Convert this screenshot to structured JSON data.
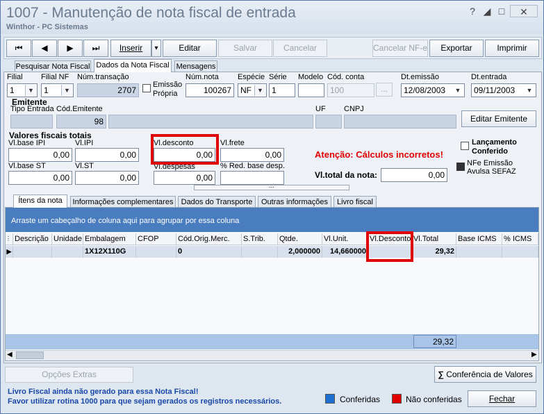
{
  "window": {
    "title": "1007 - Manutenção de nota fiscal de entrada",
    "subtitle": "Winthor - PC Sistemas",
    "help": "?",
    "minimize": "◢",
    "maximize": "□",
    "close": "✕"
  },
  "toolbar": {
    "first": "⏮",
    "prev": "◀",
    "next": "▶",
    "last": "⏭",
    "inserir": "Inserir",
    "inserir_dd": "▾",
    "editar": "Editar",
    "salvar": "Salvar",
    "cancelar": "Cancelar",
    "cancelar_nfe": "Cancelar NF-e",
    "exportar": "Exportar",
    "imprimir": "Imprimir"
  },
  "tabs": [
    "Pesquisar Nota Fiscal",
    "Dados da Nota Fiscal",
    "Mensagens"
  ],
  "header_fields": {
    "filial_label": "Filial",
    "filial_value": "1",
    "filial_nf_label": "Filial NF",
    "filial_nf_value": "1",
    "num_transacao_label": "Núm.transação",
    "num_transacao_value": "2707",
    "emissao_propria_line1": "Emissão",
    "emissao_propria_line2": "Própria",
    "num_nota_label": "Núm.nota",
    "num_nota_value": "100267",
    "especie_label": "Espécie",
    "especie_value": "NF",
    "serie_label": "Série",
    "serie_value": "1",
    "modelo_label": "Modelo",
    "modelo_value": "",
    "cod_conta_label": "Cód. conta",
    "cod_conta_value": "100",
    "cod_conta_btn": "...",
    "dt_emissao_label": "Dt.emissão",
    "dt_emissao_value": "12/08/2003",
    "dt_entrada_label": "Dt.entrada",
    "dt_entrada_value": "09/11/2003"
  },
  "emitente": {
    "section": "Emitente",
    "tipo_entrada_label": "Tipo Entrada",
    "cod_emitente_label": "Cód.Emitente",
    "cod_emitente_value": "98",
    "uf_label": "UF",
    "cnpj_label": "CNPJ",
    "editar_btn": "Editar Emitente"
  },
  "valores": {
    "section": "Valores fiscais totais",
    "base_ipi_label": "Vl.base IPI",
    "base_ipi_value": "0,00",
    "ipi_label": "Vl.IPI",
    "ipi_value": "0,00",
    "desconto_label": "Vl.desconto",
    "desconto_value": "0,00",
    "frete_label": "Vl.frete",
    "frete_value": "0,00",
    "base_st_label": "Vl.base ST",
    "base_st_value": "0,00",
    "st_label": "Vl.ST",
    "st_value": "0,00",
    "despesas_label": "Vl.despesas",
    "despesas_value": "0,00",
    "red_base_label": "% Red. base desp.",
    "red_base_value": "",
    "warning": "Atenção: Cálculos incorretos!",
    "total_label": "Vl.total da nota:",
    "total_value": "0,00",
    "lancamento_line1": "Lançamento",
    "lancamento_line2": "Conferido",
    "nfe_line1": "NFe Emissão",
    "nfe_line2": "Avulsa SEFAZ"
  },
  "subtabs": [
    "Ítens da nota",
    "Informações complementares",
    "Dados do Transporte",
    "Outras informações",
    "Livro fiscal"
  ],
  "grid": {
    "group_hint": "Arraste um cabeçalho de coluna aqui para agrupar por essa coluna",
    "columns": [
      "Descrição",
      "Unidade",
      "Embalagem",
      "CFOP",
      "Cód.Orig.Merc.",
      "S.Trib.",
      "Qtde.",
      "Vl.Unit.",
      "Vl.Desconto",
      "Vl.Total",
      "Base ICMS",
      "% ICMS"
    ],
    "row": [
      "",
      "",
      "1X12X110G",
      "",
      "0",
      "",
      "2,000000",
      "14,660000",
      "",
      "29,32",
      "",
      ""
    ],
    "footer_total": "29,32",
    "row_indicator": "▶"
  },
  "bottom": {
    "opcoes_extras": "Opções Extras",
    "conferencia": "Conferência de Valores",
    "sigma": "∑",
    "msg_line1": "Livro Fiscal ainda não gerado para essa Nota Fiscal!",
    "msg_line2": "Favor utilizar rotina 1000 para que sejam gerados os registros necessários.",
    "legend_conferidas": "Conferidas",
    "legend_nao_conferidas": "Não conferidas",
    "fechar": "Fechar"
  },
  "colors": {
    "conferidas": "#1e6fd0",
    "nao_conferidas": "#e00000",
    "warning": "#e00000",
    "grid_band": "#4a7cc0"
  }
}
